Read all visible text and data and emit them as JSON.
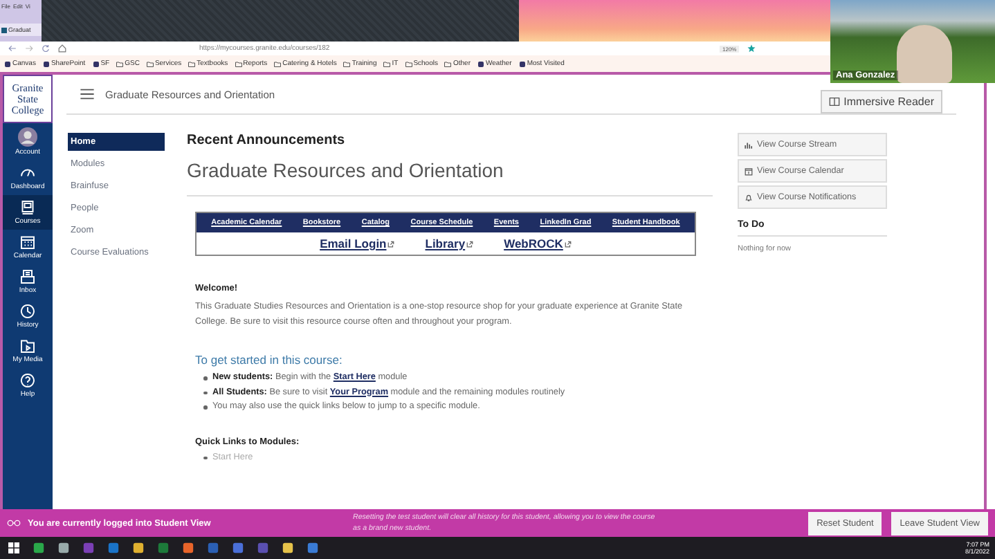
{
  "browser": {
    "menu": [
      "File",
      "Edit",
      "Vi"
    ],
    "tab_title": "Graduat",
    "url": "https://mycourses.granite.edu/courses/182",
    "zoom": "120%",
    "bookmarks": [
      {
        "label": "Canvas",
        "kind": "site"
      },
      {
        "label": "SharePoint",
        "kind": "site"
      },
      {
        "label": "SF",
        "kind": "site"
      },
      {
        "label": "GSC",
        "kind": "folder"
      },
      {
        "label": "Services",
        "kind": "folder"
      },
      {
        "label": "Textbooks",
        "kind": "folder"
      },
      {
        "label": "Reports",
        "kind": "folder"
      },
      {
        "label": "Catering & Hotels",
        "kind": "folder"
      },
      {
        "label": "Training",
        "kind": "folder"
      },
      {
        "label": "IT",
        "kind": "folder"
      },
      {
        "label": "Schools",
        "kind": "folder"
      },
      {
        "label": "Other",
        "kind": "folder"
      },
      {
        "label": "Weather",
        "kind": "site"
      },
      {
        "label": "Most Visited",
        "kind": "site"
      }
    ]
  },
  "webcam": {
    "name": "Ana Gonzalez"
  },
  "logo": [
    "Granite",
    "State",
    "College"
  ],
  "global_nav": [
    {
      "label": "Account",
      "selected": false
    },
    {
      "label": "Dashboard",
      "selected": false
    },
    {
      "label": "Courses",
      "selected": true
    },
    {
      "label": "Calendar",
      "selected": false
    },
    {
      "label": "Inbox",
      "selected": false
    },
    {
      "label": "History",
      "selected": false
    },
    {
      "label": "My Media",
      "selected": false
    },
    {
      "label": "Help",
      "selected": false
    }
  ],
  "breadcrumb": "Graduate Resources and Orientation",
  "immersive_reader": "Immersive Reader",
  "course_nav": [
    {
      "label": "Home",
      "selected": true
    },
    {
      "label": "Modules",
      "selected": false
    },
    {
      "label": "Brainfuse",
      "selected": false
    },
    {
      "label": "People",
      "selected": false
    },
    {
      "label": "Zoom",
      "selected": false
    },
    {
      "label": "Course Evaluations",
      "selected": false
    }
  ],
  "announcements_heading": "Recent Announcements",
  "page_title": "Graduate Resources and Orientation",
  "quick_links_top": [
    "Academic Calendar",
    "Bookstore",
    "Catalog",
    "Course Schedule",
    "Events",
    "LinkedIn Grad",
    "Student Handbook"
  ],
  "quick_links_bottom": [
    "Email Login",
    "Library",
    "WebROCK"
  ],
  "welcome_heading": "Welcome!",
  "welcome_text": "This Graduate Studies Resources and Orientation is a one-stop resource shop for your graduate experience at Granite State College. Be sure to visit this resource course often and throughout your program.",
  "started_heading": "To get started in this course:",
  "bullets": [
    [
      {
        "text": "New students:",
        "kind": "bold"
      },
      {
        "text": " Begin with the ",
        "kind": "plain"
      },
      {
        "text": "Start Here",
        "kind": "link"
      },
      {
        "text": " module",
        "kind": "plain"
      }
    ],
    [
      {
        "text": "All Students:",
        "kind": "bold"
      },
      {
        "text": " Be sure to visit ",
        "kind": "plain"
      },
      {
        "text": "Your Program",
        "kind": "link"
      },
      {
        "text": " module and the remaining modules routinely",
        "kind": "plain"
      }
    ],
    [
      {
        "text": "You may also use the quick links below to jump to a specific module.",
        "kind": "plain"
      }
    ]
  ],
  "modules_heading": "Quick Links to Modules:",
  "module_links": [
    "Start Here"
  ],
  "side_buttons": [
    "View Course Stream",
    "View Course Calendar",
    "View Course Notifications"
  ],
  "todo_heading": "To Do",
  "todo_empty": "Nothing for now",
  "student_view": {
    "message": "You are currently logged into Student View",
    "note": "Resetting the test student will clear all history for this student, allowing you to view the course as a brand new student.",
    "buttons": [
      "Reset Student",
      "Leave Student View"
    ]
  },
  "clock": {
    "time": "7:07 PM",
    "date": "8/1/2022"
  }
}
